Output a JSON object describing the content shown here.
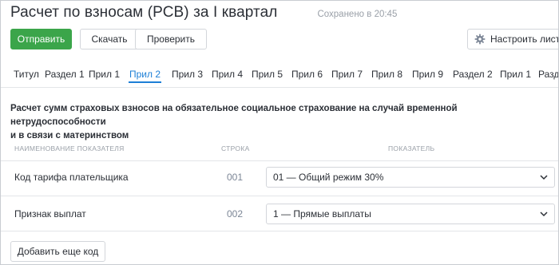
{
  "header": {
    "title": "Расчет по взносам (РСВ) за I квартал",
    "saved_status": "Сохранено в 20:45"
  },
  "toolbar": {
    "send_label": "Отправить",
    "download_label": "Скачать",
    "check_label": "Проверить",
    "configure_label": "Настроить листы"
  },
  "tabs": [
    {
      "label": "Титул",
      "active": false
    },
    {
      "label": "Раздел 1",
      "active": false
    },
    {
      "label": "Прил 1",
      "active": false
    },
    {
      "label": "Прил 2",
      "active": true
    },
    {
      "label": "Прил 3",
      "active": false
    },
    {
      "label": "Прил 4",
      "active": false
    },
    {
      "label": "Прил 5",
      "active": false
    },
    {
      "label": "Прил 6",
      "active": false
    },
    {
      "label": "Прил 7",
      "active": false
    },
    {
      "label": "Прил 8",
      "active": false
    },
    {
      "label": "Прил 9",
      "active": false
    },
    {
      "label": "Раздел 2",
      "active": false
    },
    {
      "label": "Прил 1",
      "active": false
    },
    {
      "label": "Разде",
      "active": false
    }
  ],
  "section": {
    "title_line1": "Расчет сумм страховых взносов на обязательное социальное страхование на случай временной нетрудоспособности",
    "title_line2": "и в связи с материнством"
  },
  "table": {
    "headers": {
      "name": "НАИМЕНОВАНИЕ ПОКАЗАТЕЛЯ",
      "line": "СТРОКА",
      "value": "ПОКАЗАТЕЛЬ"
    },
    "rows": [
      {
        "label": "Код тарифа плательщика",
        "code": "001",
        "value": "01 — Общий режим 30%"
      },
      {
        "label": "Признак выплат",
        "code": "002",
        "value": "1 — Прямые выплаты"
      }
    ]
  },
  "add_code_label": "Добавить еще код",
  "colors": {
    "primary": "#3ba54a",
    "tab_active": "#1d7fd6",
    "muted": "#9aa0a8",
    "border": "#d3d6db"
  }
}
